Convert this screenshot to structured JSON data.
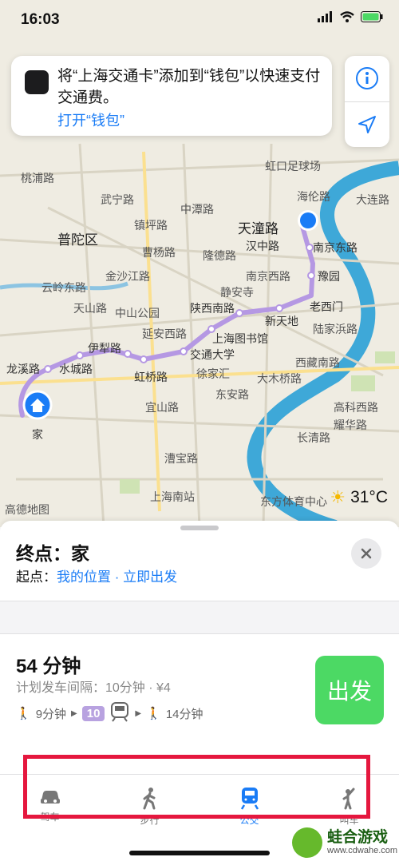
{
  "status_bar": {
    "time": "16:03"
  },
  "wallet_banner": {
    "message": "将“上海交通卡”添加到“钱包”以快速支付交通费。",
    "action_label": "打开“钱包”"
  },
  "map": {
    "district_labels": [
      "桃浦路",
      "普陀区",
      "镇坪路",
      "中潭路",
      "天潼路",
      "汉中路",
      "南京东路",
      "豫园",
      "老西门",
      "新天地",
      "陕西南路",
      "静安寺",
      "南京西路",
      "金沙江路",
      "中山公园",
      "延安西路",
      "上海图书馆",
      "交通大学",
      "徐家汇",
      "伊犁路",
      "水城路",
      "龙溪路",
      "虹桥路",
      "宜山路",
      "漕宝路",
      "上海南站",
      "东方体育中心",
      "长清路",
      "大木桥路",
      "西藏南路",
      "陆家浜路",
      "高科西路",
      "耀华路",
      "东安路",
      "海伦路",
      "大连路",
      "虹口足球场",
      "曹杨路",
      "隆德路",
      "武宁路",
      "云岭东路",
      "天山路",
      "家"
    ],
    "logo": "高德地图",
    "weather_temp": "31°C"
  },
  "route_sheet": {
    "destination_label": "终点：家",
    "origin_prefix": "起点：",
    "origin_value": "我的位置",
    "separator": " · ",
    "departure": "立即出发",
    "duration": "54 分钟",
    "details": "计划发车间隔：10分钟 · ¥4",
    "walk_start": "9分钟",
    "line_number": "10",
    "walk_end": "14分钟",
    "go_button": "出发"
  },
  "tabs": [
    {
      "label": "驾车",
      "icon": "car-icon"
    },
    {
      "label": "步行",
      "icon": "walk-icon"
    },
    {
      "label": "公交",
      "icon": "transit-icon",
      "active": true
    },
    {
      "label": "叫车",
      "icon": "hail-icon"
    }
  ],
  "watermark": {
    "title": "蛙合游戏",
    "url": "www.cdwahe.com"
  },
  "colors": {
    "accent": "#1a7cf6",
    "go": "#4cd964",
    "route": "#b598e3",
    "highlight_box": "#e5173e",
    "water": "#3ea8d8"
  }
}
